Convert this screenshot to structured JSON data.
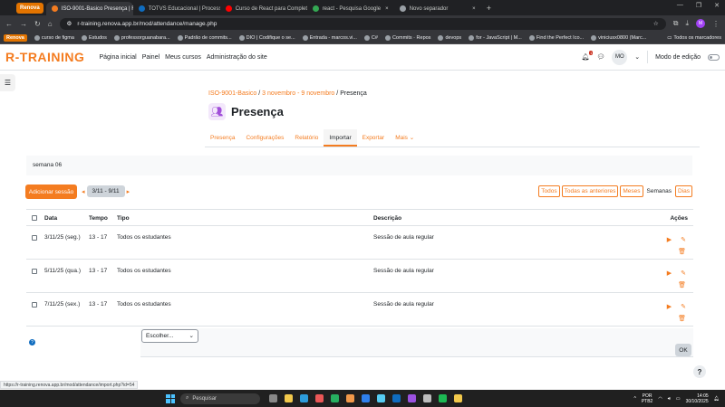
{
  "browser": {
    "tab_group": "Renova",
    "tabs": [
      {
        "label": "ISO-9001-Basico Presença | R",
        "color": "#f47c20",
        "active": true
      },
      {
        "label": "TOTVS Educacional | Processo",
        "color": "#0f6cbf",
        "active": false
      },
      {
        "label": "Curso de React para Completo",
        "color": "#ff0000",
        "active": false
      },
      {
        "label": "react - Pesquisa Google",
        "color": "#34a853",
        "active": false
      },
      {
        "label": "Novo separador",
        "color": "#9aa0a6",
        "active": false
      }
    ],
    "url": "r-training.renova.app.br/mod/attendance/manage.php",
    "profile_initial": "M",
    "bookmarks": [
      {
        "label": "Renova",
        "special": true
      },
      "curso de figma",
      "Estudos",
      "professorguanabara...",
      "Padrão de commits...",
      "DIO | Codifique o se...",
      "Entrada - marcos.vi...",
      "C#",
      "Commits · Repos",
      "devops",
      "for - JavaScript | M...",
      "Find the Perfect Ico...",
      "viniciusx0800 (Marc..."
    ],
    "bookmarks_right": "Todos os marcadores"
  },
  "site": {
    "logo": "R-TRAINING",
    "nav": [
      "Página inicial",
      "Painel",
      "Meus cursos",
      "Administração do site"
    ],
    "notif_count": "1",
    "user_initials": "MO",
    "edit_mode_label": "Modo de edição"
  },
  "breadcrumb": {
    "course": "ISO-9001-Basico",
    "section": "3 novembro - 9 novembro",
    "current": "Presença",
    "sep": "/"
  },
  "page": {
    "title": "Presença",
    "secondary_nav": [
      "Presença",
      "Configurações",
      "Relatório",
      "Importar",
      "Exportar",
      "Mais ⌄"
    ],
    "active_tab": "Importar",
    "week_label": "semana 06"
  },
  "toolbar": {
    "add_session": "Adicionar sessão",
    "date_range": "3/11 - 9/11",
    "views": [
      {
        "label": "Todos",
        "current": false
      },
      {
        "label": "Todas as anteriores",
        "current": false
      },
      {
        "label": "Meses",
        "current": false
      },
      {
        "label": "Semanas",
        "current": true
      },
      {
        "label": "Dias",
        "current": false
      }
    ]
  },
  "table": {
    "headers": {
      "date": "Data",
      "time": "Tempo",
      "type": "Tipo",
      "description": "Descrição",
      "actions": "Ações"
    },
    "rows": [
      {
        "date": "3/11/25 (seg.)",
        "time": "13 - 17",
        "type": "Todos os estudantes",
        "description": "Sessão de aula regular"
      },
      {
        "date": "5/11/25 (qua.)",
        "time": "13 - 17",
        "type": "Todos os estudantes",
        "description": "Sessão de aula regular"
      },
      {
        "date": "7/11/25 (sex.)",
        "time": "13 - 17",
        "type": "Todos os estudantes",
        "description": "Sessão de aula regular"
      }
    ]
  },
  "bulk": {
    "select_value": "Escolher...",
    "ok_label": "OK"
  },
  "status_url": "https://r-training.renova.app.br/mod/attendance/import.php?id=54",
  "taskbar": {
    "search": "Pesquisar",
    "lang": "POR",
    "layout": "PTB2",
    "time": "14:05",
    "date": "30/10/2025"
  }
}
